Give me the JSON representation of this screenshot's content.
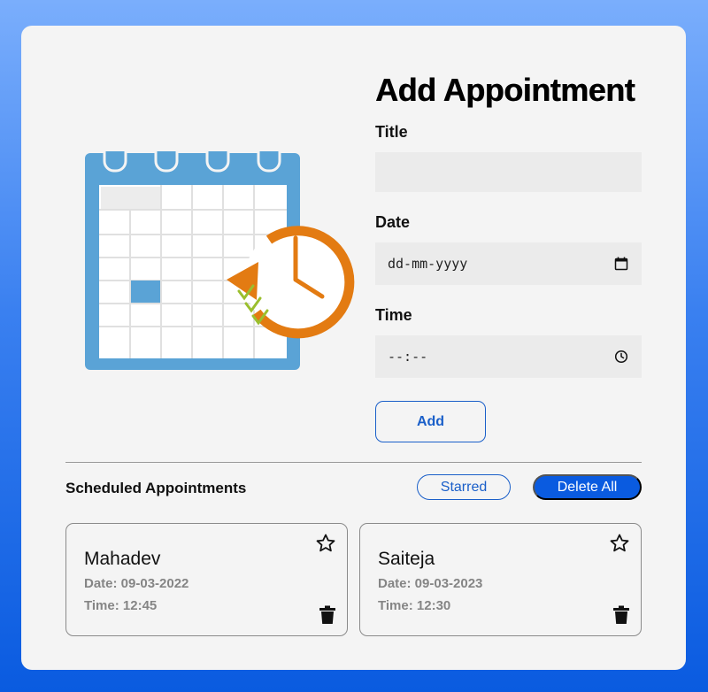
{
  "form": {
    "heading": "Add Appointment",
    "title_label": "Title",
    "title_value": "",
    "date_label": "Date",
    "date_placeholder": "dd-mm-yyyy",
    "time_label": "Time",
    "time_placeholder": "--:--",
    "add_label": "Add"
  },
  "list": {
    "heading": "Scheduled Appointments",
    "starred_label": "Starred",
    "delete_all_label": "Delete All",
    "appointments": [
      {
        "title": "Mahadev",
        "date": "Date: 09-03-2022",
        "time": "Time: 12:45",
        "starred": false
      },
      {
        "title": "Saiteja",
        "date": "Date: 09-03-2023",
        "time": "Time: 12:30",
        "starred": false
      }
    ]
  },
  "icons": {
    "calendar": "calendar-clock-illustration",
    "date_input": "calendar-icon",
    "time_input": "clock-icon",
    "star": "star-outline-icon",
    "delete": "trash-icon"
  },
  "colors": {
    "accent": "#0a5be0",
    "outline": "#1a5fc9",
    "calendar_blue": "#5aa3d6",
    "clock_orange": "#e37b12",
    "check_green": "#9bbf2e"
  }
}
